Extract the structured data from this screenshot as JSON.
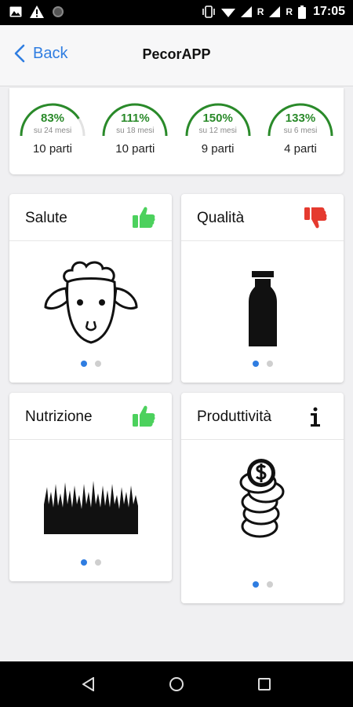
{
  "status_bar": {
    "time": "17:05",
    "roaming_1": "R",
    "roaming_2": "R"
  },
  "header": {
    "back_label": "Back",
    "title": "PecorAPP"
  },
  "summary": {
    "gauges": [
      {
        "percent": "83%",
        "period": "su 24 mesi",
        "births": "10 parti"
      },
      {
        "percent": "111%",
        "period": "su 18 mesi",
        "births": "10 parti"
      },
      {
        "percent": "150%",
        "period": "su 12 mesi",
        "births": "9 parti"
      },
      {
        "percent": "133%",
        "period": "su 6 mesi",
        "births": "4 parti"
      }
    ],
    "accent_color": "#2a8a2a"
  },
  "tiles": {
    "health": {
      "title": "Salute",
      "status": "thumbs-up-icon",
      "status_color": "#4cd15d"
    },
    "quality": {
      "title": "Qualità",
      "status": "thumbs-down-icon",
      "status_color": "#e53a2f"
    },
    "nutrition": {
      "title": "Nutrizione",
      "status": "thumbs-up-icon",
      "status_color": "#4cd15d"
    },
    "productivity": {
      "title": "Produttività",
      "status": "info-icon"
    }
  },
  "colors": {
    "link": "#2f7de1",
    "dot_active": "#2f7de1",
    "dot_inactive": "#cfcfcf"
  }
}
